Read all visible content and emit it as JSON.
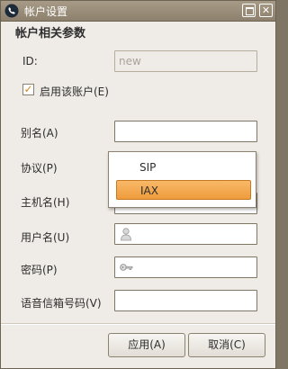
{
  "window": {
    "title": "帐户设置"
  },
  "section_title": "帐户相关参数",
  "fields": {
    "id_label": "ID:",
    "id_placeholder": "new",
    "enable_label": "启用该账户(E)",
    "enable_checked": true,
    "alias_label": "别名(A)",
    "protocol_label": "协议(P)",
    "host_label": "主机名(H)",
    "username_label": "用户名(U)",
    "password_label": "密码(P)",
    "voicemail_label": "语音信箱号码(V)"
  },
  "protocol_dropdown": {
    "options": [
      "SIP",
      "IAX"
    ],
    "selected": "IAX"
  },
  "buttons": {
    "apply": "应用(A)",
    "cancel": "取消(C)"
  },
  "colors": {
    "titlebar": "#9b8e79",
    "selection": "#f2a54a",
    "checkmark": "#d08a1d"
  }
}
